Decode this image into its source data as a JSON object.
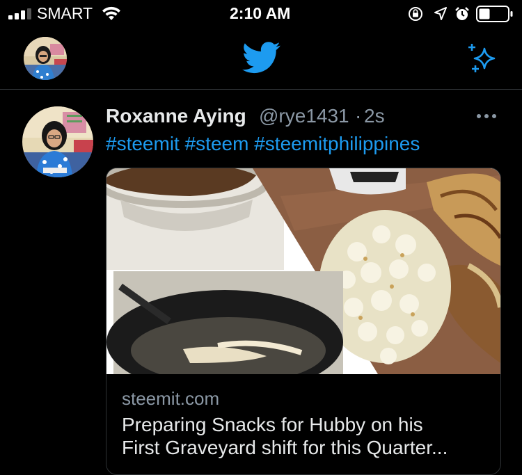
{
  "status_bar": {
    "carrier": "SMART",
    "time": "2:10 AM",
    "icons": [
      "signal-icon",
      "wifi-icon",
      "orientation-lock-icon",
      "location-icon",
      "alarm-icon",
      "battery-icon"
    ]
  },
  "header": {
    "logo_icon": "twitter-bird-icon",
    "right_icon": "sparkle-icon",
    "accent_color": "#1d9bf0"
  },
  "tweet": {
    "author_name": "Roxanne Aying",
    "handle": "@rye1431",
    "separator": "·",
    "time_ago": "2s",
    "hashtags": [
      "#steemit",
      "#steem",
      "#steemitphilippines"
    ],
    "card": {
      "domain": "steemit.com",
      "title_line1": "Preparing Snacks for Hubby on his",
      "title_line2": "First Graveyard shift for this Quarter..."
    }
  }
}
